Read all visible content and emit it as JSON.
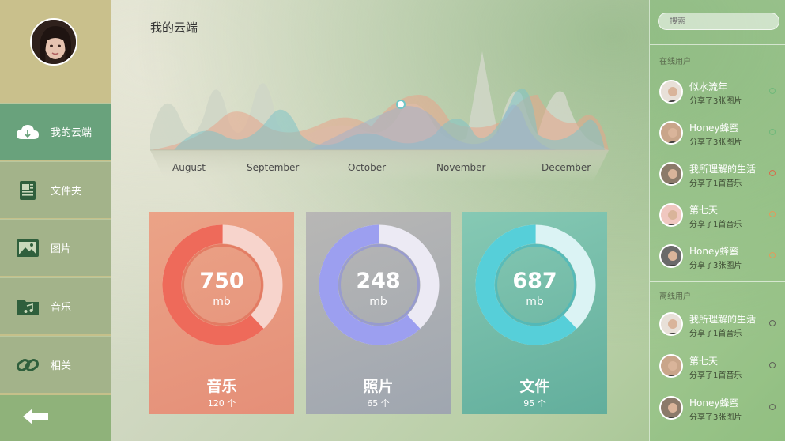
{
  "colors": {
    "nav_bg": "#c5c08a",
    "nav_active": "#69a27c",
    "card_music": "#e8957f",
    "card_photo": "#a7abb5",
    "card_file": "#6fb8a6",
    "dot_green": "#6fb87a",
    "dot_red": "#d86a4a",
    "dot_orange": "#e39a5a",
    "dot_gray": "#5f6158"
  },
  "nav": {
    "avatar_icon": "user-avatar",
    "items": [
      {
        "label": "我的云端",
        "icon": "cloud-icon",
        "active": true
      },
      {
        "label": "文件夹",
        "icon": "document-icon",
        "active": false
      },
      {
        "label": "图片",
        "icon": "image-icon",
        "active": false
      },
      {
        "label": "音乐",
        "icon": "music-folder-icon",
        "active": false
      },
      {
        "label": "相关",
        "icon": "link-icon",
        "active": false
      }
    ],
    "back_icon": "arrow-left-icon"
  },
  "main": {
    "title": "我的云端",
    "months": [
      "August",
      "September",
      "October",
      "November",
      "December"
    ],
    "cards": [
      {
        "value": "750",
        "unit": "mb",
        "title": "音乐",
        "count": "120 个",
        "fill": 0.62
      },
      {
        "value": "248",
        "unit": "mb",
        "title": "照片",
        "count": "65 个",
        "fill": 0.62
      },
      {
        "value": "687",
        "unit": "mb",
        "title": "文件",
        "count": "95 个",
        "fill": 0.62
      }
    ]
  },
  "right": {
    "search_placeholder": "搜索",
    "online_label": "在线用户",
    "offline_label": "离线用户",
    "online_users": [
      {
        "name": "似水流年",
        "activity": "分享了3张图片",
        "status": "green"
      },
      {
        "name": "Honey蜂蜜",
        "activity": "分享了3张图片",
        "status": "green"
      },
      {
        "name": "我所理解的生活",
        "activity": "分享了1首音乐",
        "status": "red"
      },
      {
        "name": "第七天",
        "activity": "分享了1首音乐",
        "status": "orange"
      },
      {
        "name": "Honey蜂蜜",
        "activity": "分享了3张图片",
        "status": "orange"
      }
    ],
    "offline_users": [
      {
        "name": "我所理解的生活",
        "activity": "分享了1首音乐",
        "status": "gray"
      },
      {
        "name": "第七天",
        "activity": "分享了1首音乐",
        "status": "gray"
      },
      {
        "name": "Honey蜂蜜",
        "activity": "分享了3张图片",
        "status": "gray"
      }
    ]
  }
}
